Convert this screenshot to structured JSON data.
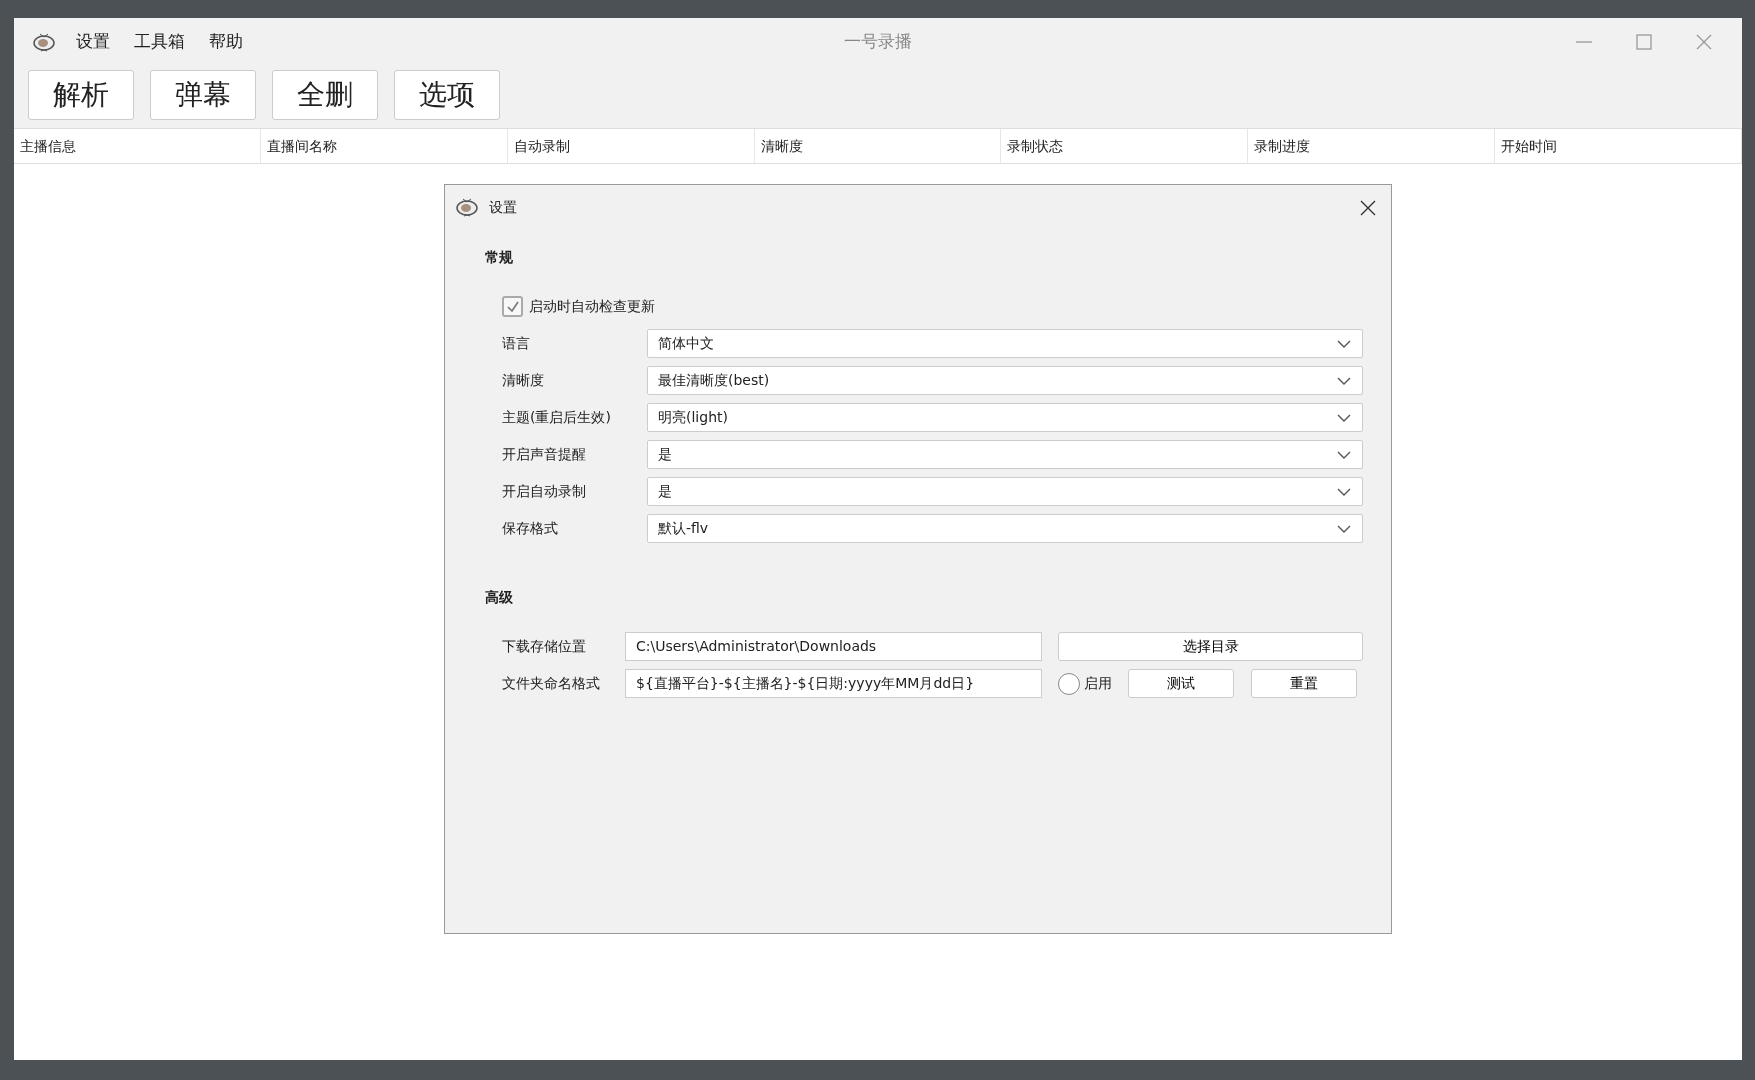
{
  "window": {
    "title": "一号录播",
    "menu": [
      "设置",
      "工具箱",
      "帮助"
    ]
  },
  "toolbar": [
    "解析",
    "弹幕",
    "全删",
    "选项"
  ],
  "table": {
    "columns": [
      "主播信息",
      "直播间名称",
      "自动录制",
      "清晰度",
      "录制状态",
      "录制进度",
      "开始时间"
    ]
  },
  "dialog": {
    "title": "设置",
    "general": {
      "heading": "常规",
      "items": [
        {
          "kind": "checkbox",
          "label": "启动时自动检查更新",
          "checked": true
        },
        {
          "kind": "select",
          "label": "语言",
          "value": "简体中文"
        },
        {
          "kind": "select",
          "label": "清晰度",
          "value": "最佳清晰度(best)"
        },
        {
          "kind": "select",
          "label": "主题(重启后生效)",
          "value": "明亮(light)"
        },
        {
          "kind": "select",
          "label": "开启声音提醒",
          "value": "是"
        },
        {
          "kind": "select",
          "label": "开启自动录制",
          "value": "是"
        },
        {
          "kind": "select",
          "label": "保存格式",
          "value": "默认-flv"
        }
      ]
    },
    "advanced": {
      "heading": "高级",
      "download_path": {
        "label": "下载存储位置",
        "value": "C:\\Users\\Administrator\\Downloads",
        "button": "选择目录"
      },
      "folder_naming": {
        "label": "文件夹命名格式",
        "value": "${直播平台}-${主播名}-${日期:yyyy年MM月dd日}",
        "radio": {
          "label": "启用",
          "selected": false
        },
        "buttons": [
          "测试",
          "重置"
        ]
      }
    }
  }
}
